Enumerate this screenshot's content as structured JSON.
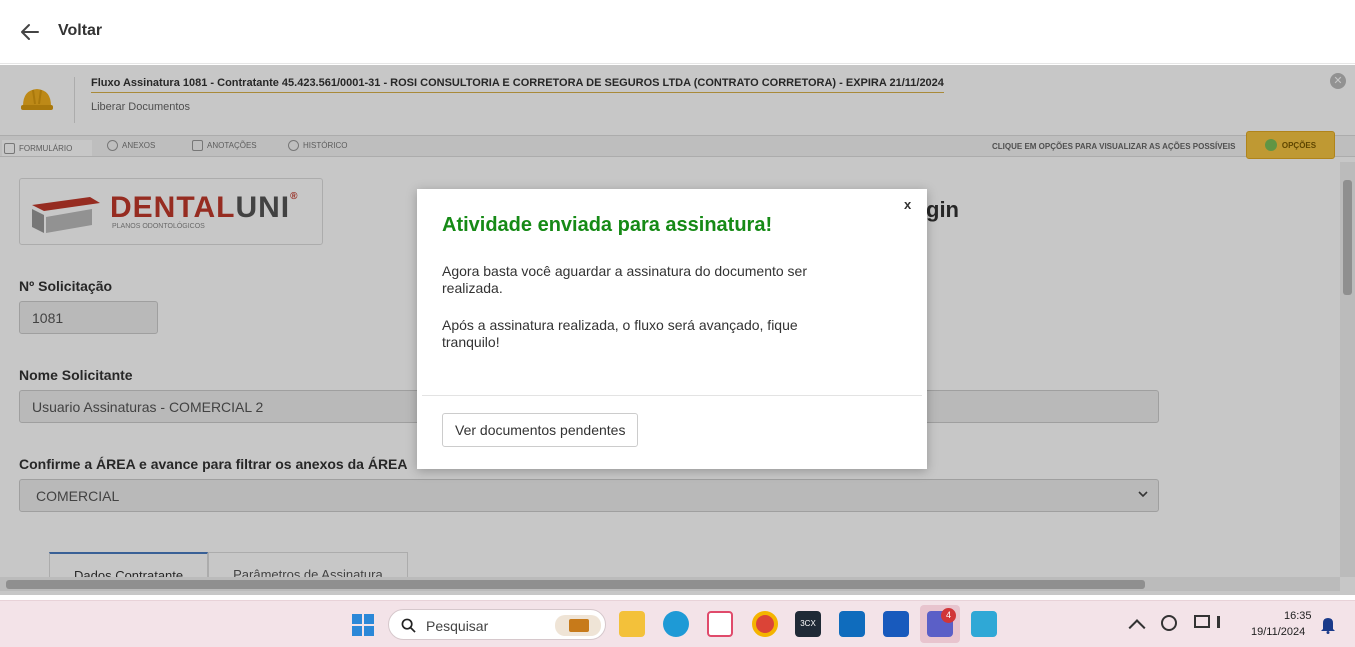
{
  "topbar": {
    "back_label": "Voltar"
  },
  "header": {
    "flow_title": "Fluxo Assinatura 1081 - Contratante 45.423.561/0001-31 - ROSI CONSULTORIA E CORRETORA DE SEGUROS LTDA (CONTRATO CORRETORA) - EXPIRA 21/11/2024",
    "flow_subtitle": "Liberar Documentos"
  },
  "tabs": [
    {
      "label": "FORMULÁRIO"
    },
    {
      "label": "ANEXOS"
    },
    {
      "label": "ANOTAÇÕES"
    },
    {
      "label": "HISTÓRICO"
    }
  ],
  "options_hint": "CLIQUE EM OPÇÕES PARA VISUALIZAR AS AÇÕES POSSÍVEIS",
  "options_label": "OPÇÕES",
  "logo": {
    "main": "DENTAL",
    "accent": "UNI",
    "reg": "®",
    "tagline": "PLANOS ODONTOLÓGICOS"
  },
  "page_heading_partial": "gin",
  "form": {
    "solicitacao_label": "Nº Solicitação",
    "solicitacao_value": "1081",
    "solicitante_label": "Nome Solicitante",
    "solicitante_value": "Usuario Assinaturas - COMERCIAL 2",
    "area_label": "Confirme a ÁREA e avance para filtrar os anexos da ÁREA",
    "area_value": "COMERCIAL",
    "subtabs": [
      "Dados Contratante",
      "Parâmetros de Assinatura"
    ]
  },
  "modal": {
    "close": "x",
    "title": "Atividade enviada para assinatura!",
    "p1": "Agora basta você aguardar a assinatura do documento ser realizada.",
    "p2": "Após a assinatura realizada, o fluxo será avançado, fique tranquilo!",
    "button": "Ver documentos pendentes"
  },
  "taskbar": {
    "search_placeholder": "Pesquisar",
    "time": "16:35",
    "date": "19/11/2024",
    "teams_badge": "4"
  },
  "colors": {
    "success_title": "#168a16",
    "options_yellow": "#f5c542",
    "brand_red": "#c0392b"
  }
}
